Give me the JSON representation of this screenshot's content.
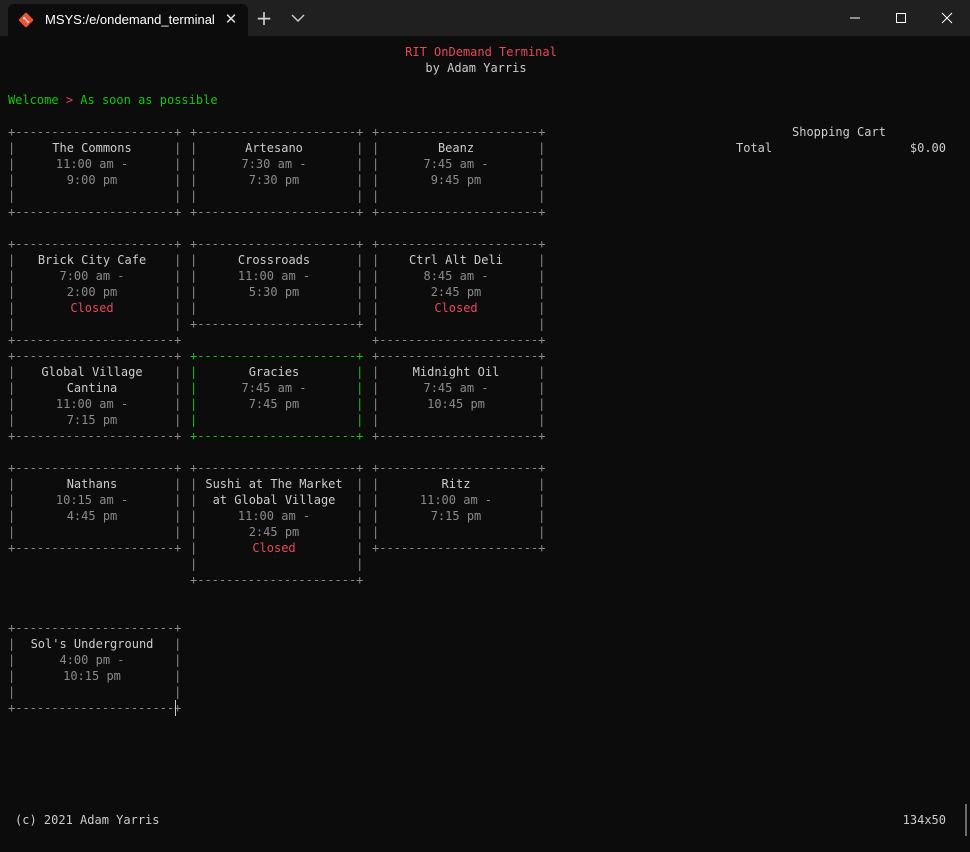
{
  "window": {
    "tab_title": "MSYS:/e/ondemand_terminal",
    "icons": {
      "tab": "git-icon",
      "close_tab": "close-icon",
      "new_tab": "plus-icon",
      "dropdown": "chevron-down-icon",
      "minimize": "minimize-icon",
      "maximize": "maximize-icon",
      "close": "close-icon"
    }
  },
  "header": {
    "title": "RIT OnDemand Terminal",
    "byline": "by Adam Yarris"
  },
  "breadcrumb": {
    "step1": "Welcome",
    "separator": ">",
    "step2": "As soon as possible"
  },
  "cart": {
    "title": "Shopping Cart",
    "total_label": "Total",
    "total_value": "$0.00"
  },
  "restaurants": [
    {
      "name": [
        "The Commons"
      ],
      "open": "11:00 am -",
      "close": "9:00 pm",
      "status": ""
    },
    {
      "name": [
        "Artesano"
      ],
      "open": "7:30 am -",
      "close": "7:30 pm",
      "status": ""
    },
    {
      "name": [
        "Beanz"
      ],
      "open": "7:45 am -",
      "close": "9:45 pm",
      "status": ""
    },
    {
      "name": [
        "Brick City Cafe"
      ],
      "open": "7:00 am -",
      "close": "2:00 pm",
      "status": "Closed"
    },
    {
      "name": [
        "Crossroads"
      ],
      "open": "11:00 am -",
      "close": "5:30 pm",
      "status": ""
    },
    {
      "name": [
        "Ctrl Alt Deli"
      ],
      "open": "8:45 am -",
      "close": "2:45 pm",
      "status": "Closed"
    },
    {
      "name": [
        "Global Village",
        "Cantina"
      ],
      "open": "11:00 am -",
      "close": "7:15 pm",
      "status": ""
    },
    {
      "name": [
        "Gracies"
      ],
      "open": "7:45 am -",
      "close": "7:45 pm",
      "status": ""
    },
    {
      "name": [
        "Midnight Oil"
      ],
      "open": "7:45 am -",
      "close": "10:45 pm",
      "status": ""
    },
    {
      "name": [
        "Nathans"
      ],
      "open": "10:15 am -",
      "close": "4:45 pm",
      "status": ""
    },
    {
      "name": [
        "Sushi at The Market",
        "at Global Village"
      ],
      "open": "11:00 am -",
      "close": "2:45 pm",
      "status": "Closed"
    },
    {
      "name": [
        "Ritz"
      ],
      "open": "11:00 am -",
      "close": "7:15 pm",
      "status": ""
    },
    {
      "name": [
        "Sol's Underground"
      ],
      "open": "4:00 pm -",
      "close": "10:15 pm",
      "status": ""
    }
  ],
  "selected_restaurant": "Gracies",
  "footer": {
    "copyright": "(c) 2021 Adam Yarris",
    "size": "134x50"
  },
  "colors": {
    "background": "#0c0c0c",
    "text": "#cccccc",
    "accent_red": "#e74856",
    "accent_green": "#16c60c",
    "muted": "#8a8a8a"
  }
}
